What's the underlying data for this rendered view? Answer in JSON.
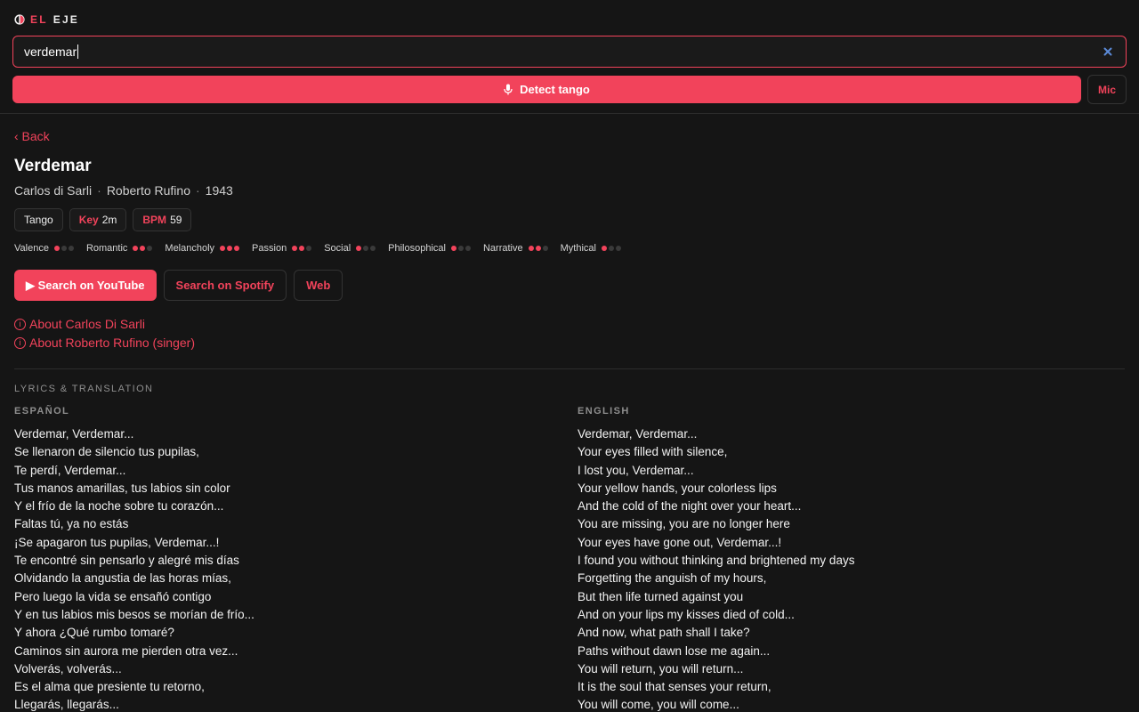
{
  "app": {
    "logo_el": "EL",
    "logo_eje": "EJE"
  },
  "search": {
    "value": "verdemar"
  },
  "detect": {
    "label": "Detect tango"
  },
  "mic": {
    "label": "Mic"
  },
  "nav": {
    "back": "‹ Back"
  },
  "track": {
    "title": "Verdemar",
    "orchestra": "Carlos di Sarli",
    "singer": "Roberto Rufino",
    "year": "1943",
    "genre": "Tango",
    "key_label": "Key",
    "key_value": "2m",
    "bpm_label": "BPM",
    "bpm_value": "59"
  },
  "moods": [
    {
      "label": "Valence",
      "level": 1
    },
    {
      "label": "Romantic",
      "level": 2
    },
    {
      "label": "Melancholy",
      "level": 3
    },
    {
      "label": "Passion",
      "level": 2
    },
    {
      "label": "Social",
      "level": 1
    },
    {
      "label": "Philosophical",
      "level": 1
    },
    {
      "label": "Narrative",
      "level": 2
    },
    {
      "label": "Mythical",
      "level": 1
    }
  ],
  "actions": {
    "youtube": "▶ Search on YouTube",
    "spotify": "Search on Spotify",
    "web": "Web"
  },
  "about": {
    "orchestra": "About Carlos Di Sarli",
    "singer": "About Roberto Rufino (singer)"
  },
  "lyrics": {
    "section_title": "LYRICS & TRANSLATION",
    "es_heading": "ESPAÑOL",
    "en_heading": "ENGLISH",
    "es": [
      "Verdemar, Verdemar...",
      "Se llenaron de silencio tus pupilas,",
      "Te perdí, Verdemar...",
      "Tus manos amarillas, tus labios sin color",
      "Y el frío de la noche sobre tu corazón...",
      "Faltas tú, ya no estás",
      "¡Se apagaron tus pupilas, Verdemar...!",
      "Te encontré sin pensarlo y alegré mis días",
      "Olvidando la angustia de las horas mías,",
      "Pero luego la vida se ensañó contigo",
      "Y en tus labios mis besos se morían de frío...",
      "Y ahora ¿Qué rumbo tomaré?",
      "Caminos sin aurora me pierden otra vez...",
      "Volverás, volverás...",
      "Es el alma que presiente tu retorno,",
      "Llegarás, llegarás..."
    ],
    "en": [
      "Verdemar, Verdemar...",
      "Your eyes filled with silence,",
      "I lost you, Verdemar...",
      "Your yellow hands, your colorless lips",
      "And the cold of the night over your heart...",
      "You are missing, you are no longer here",
      "Your eyes have gone out, Verdemar...!",
      "I found you without thinking and brightened my days",
      "Forgetting the anguish of my hours,",
      "But then life turned against you",
      "And on your lips my kisses died of cold...",
      "And now, what path shall I take?",
      "Paths without dawn lose me again...",
      "You will return, you will return...",
      "It is the soul that senses your return,",
      "You will come, you will come..."
    ]
  },
  "colors": {
    "accent": "#f2435b",
    "background": "#151515"
  },
  "icons": {
    "logo": "logo-icon",
    "clear": "close-icon",
    "mic": "microphone-icon",
    "info": "info-icon"
  }
}
